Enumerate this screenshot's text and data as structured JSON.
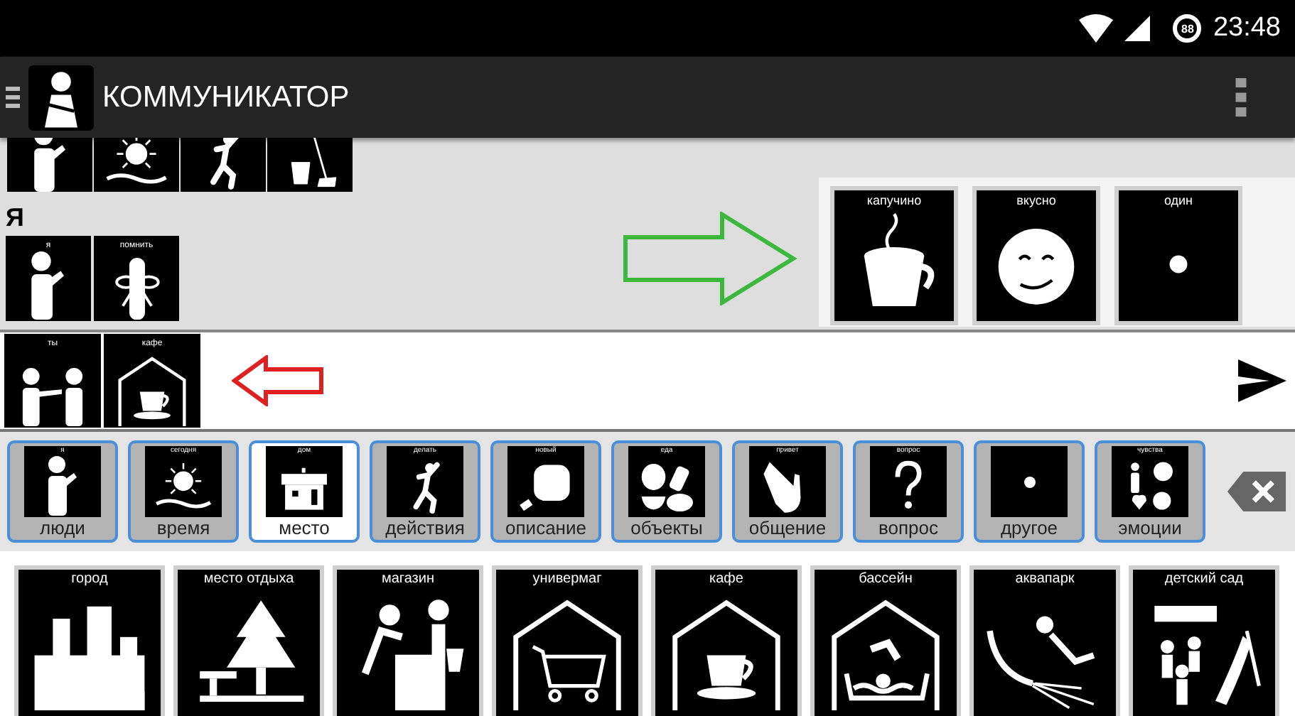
{
  "status_bar": {
    "battery": "88",
    "time": "23:48"
  },
  "app_bar": {
    "title": "КОММУНИКАТОР"
  },
  "section": {
    "heading": "Я",
    "cards": [
      {
        "label": "я"
      },
      {
        "label": "помнить"
      }
    ]
  },
  "suggestions": [
    {
      "label": "капучино"
    },
    {
      "label": "вкусно"
    },
    {
      "label": "один"
    }
  ],
  "sentence": [
    {
      "label": "ты"
    },
    {
      "label": "кафе"
    }
  ],
  "categories": [
    {
      "caption": "я",
      "label": "люди",
      "selected": false
    },
    {
      "caption": "сегодня",
      "label": "время",
      "selected": false
    },
    {
      "caption": "дом",
      "label": "место",
      "selected": true
    },
    {
      "caption": "делать",
      "label": "действия",
      "selected": false
    },
    {
      "caption": "новый",
      "label": "описание",
      "selected": false
    },
    {
      "caption": "еда",
      "label": "объекты",
      "selected": false
    },
    {
      "caption": "привет",
      "label": "общение",
      "selected": false
    },
    {
      "caption": "вопрос",
      "label": "вопрос",
      "selected": false
    },
    {
      "label": "другое",
      "selected": false
    },
    {
      "caption": "чувства",
      "label": "эмоции",
      "selected": false
    }
  ],
  "grid": [
    {
      "label": "город"
    },
    {
      "label": "место отдыха"
    },
    {
      "label": "магазин"
    },
    {
      "label": "универмаг"
    },
    {
      "label": "кафе"
    },
    {
      "label": "бассейн"
    },
    {
      "label": "аквапарк"
    },
    {
      "label": "детский сад"
    }
  ]
}
